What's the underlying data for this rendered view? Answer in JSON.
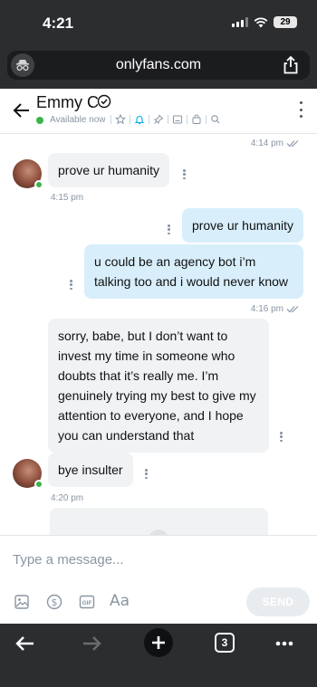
{
  "status_bar": {
    "time": "4:21",
    "battery": "29"
  },
  "browser": {
    "url": "onlyfans.com",
    "open_tabs": "3"
  },
  "chat": {
    "name": "Emmy C",
    "availability": "Available now"
  },
  "messages": [
    {
      "direction": "timestamp",
      "time": "4:14 pm"
    },
    {
      "direction": "incoming",
      "text": "prove ur humanity",
      "time": "4:15 pm"
    },
    {
      "direction": "outgoing",
      "text": "prove ur humanity"
    },
    {
      "direction": "outgoing",
      "text": "u could be an agency bot i’m talking too and i would never know",
      "time": "4:16 pm"
    },
    {
      "direction": "incoming",
      "text": "sorry, babe, but I don’t want to invest my time in someone who doubts that it’s really me. I’m genuinely trying my best to give my attention to everyone, and I hope you can understand that"
    },
    {
      "direction": "incoming",
      "text": "bye insulter",
      "time": "4:20 pm"
    }
  ],
  "composer": {
    "placeholder": "Type a message...",
    "send_label": "SEND",
    "format_label": "Aa",
    "gif_label": "GIF",
    "tools": [
      "image-icon",
      "dollar-icon",
      "gif-icon",
      "text-format-icon"
    ]
  },
  "colors": {
    "chrome_dark": "#2b2d2f",
    "incoming_bubble": "#f0f2f4",
    "outgoing_bubble": "#d8eefb",
    "online": "#3cb44a",
    "muted_text": "#8a96a3"
  }
}
